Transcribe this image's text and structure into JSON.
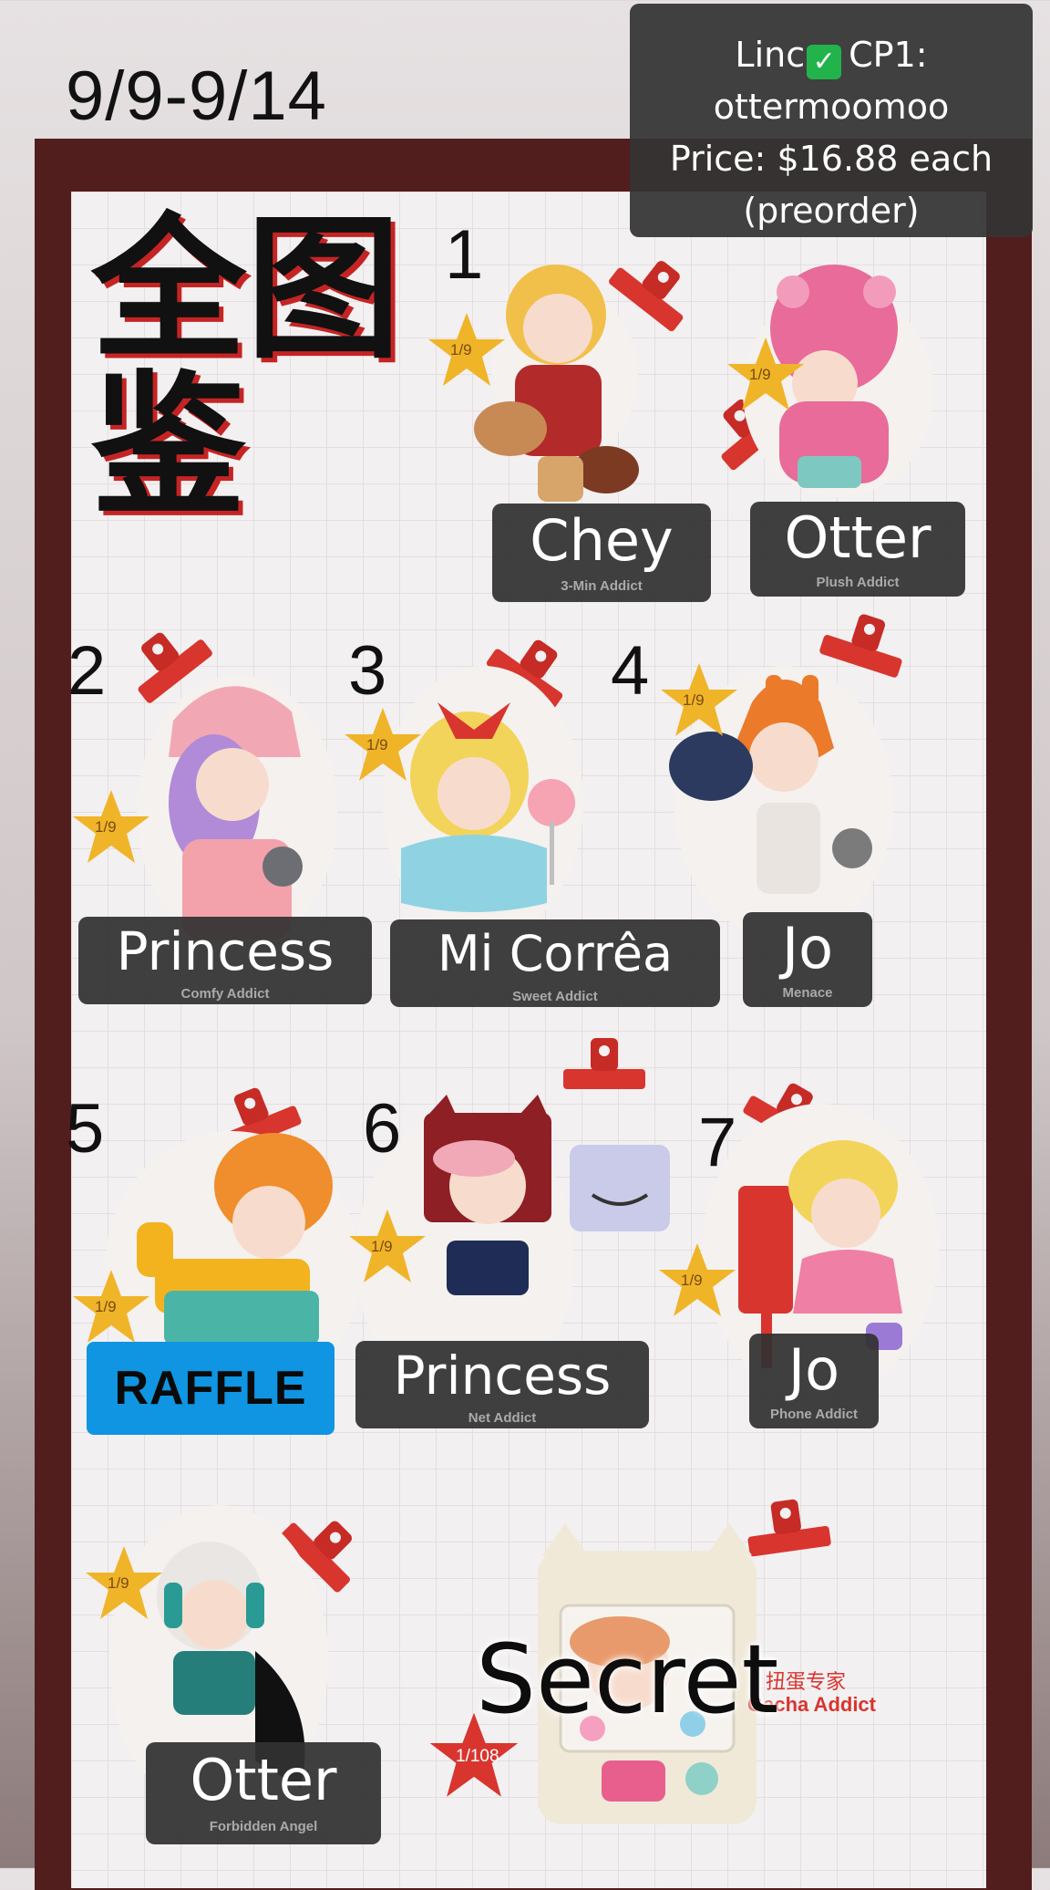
{
  "date_range": "9/9-9/14",
  "info_box": {
    "line1_name": "Linc",
    "line1_check": "✓",
    "line1_rest": "CP1:",
    "line2": "ottermoomoo",
    "line3": "Price: $16.88 each",
    "line4": "(preorder)"
  },
  "title": "全图鉴",
  "items": [
    {
      "number": "1",
      "label": "Chey",
      "caption": "3-Min Addict",
      "odds": "1/9"
    },
    {
      "number": "",
      "label": "Otter",
      "caption": "Plush Addict",
      "odds": "1/9"
    },
    {
      "number": "2",
      "label": "Princess",
      "caption": "Comfy Addict",
      "odds": "1/9"
    },
    {
      "number": "3",
      "label": "Mi Corrêa",
      "caption": "Sweet Addict",
      "odds": "1/9"
    },
    {
      "number": "4",
      "label": "Jo",
      "caption": "Menace",
      "odds": "1/9"
    },
    {
      "number": "5",
      "label": "RAFFLE",
      "caption": "",
      "odds": "1/9"
    },
    {
      "number": "6",
      "label": "Princess",
      "caption": "Net Addict",
      "odds": "1/9"
    },
    {
      "number": "7",
      "label": "Jo",
      "caption": "Phone Addict",
      "odds": "1/9"
    },
    {
      "number": "",
      "label": "Otter",
      "caption": "Forbidden Angel",
      "odds": "1/9"
    },
    {
      "number": "",
      "label": "Secret",
      "caption": "Gacha Addict",
      "caption_cn": "扭蛋专家",
      "odds": "1/108"
    }
  ],
  "colors": {
    "frame": "#521d1d",
    "panel": "#f3f0f1",
    "label_bg": "#323232",
    "raffle_bg": "#0f95e2",
    "clip_red": "#d8352f",
    "star_yellow": "#f0b429",
    "star_red": "#d8352f"
  },
  "icons": [
    "binder-clip-icon",
    "star-icon",
    "blind-box-figure"
  ]
}
